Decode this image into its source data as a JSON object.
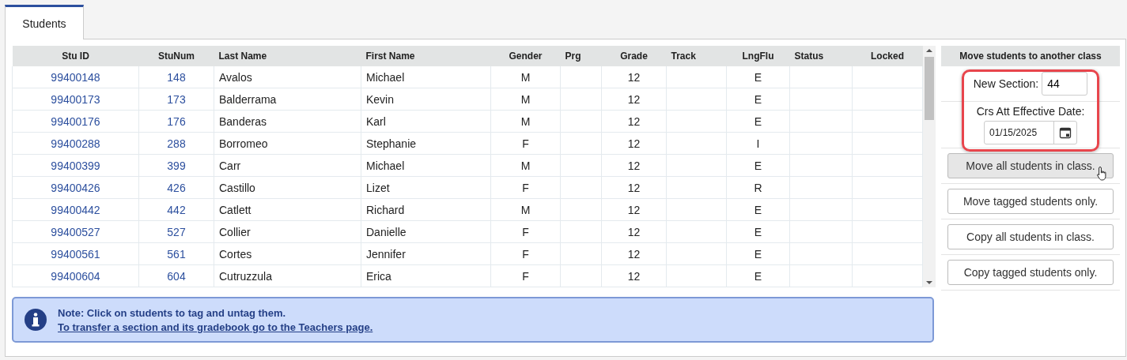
{
  "tabs": [
    {
      "label": "Students",
      "selected": true
    }
  ],
  "table": {
    "columns": [
      "Stu ID",
      "StuNum",
      "Last Name",
      "First Name",
      "Gender",
      "Prg",
      "Grade",
      "Track",
      "LngFlu",
      "Status",
      "Locked"
    ],
    "rows": [
      [
        "99400148",
        "148",
        "Avalos",
        "Michael",
        "M",
        "",
        "12",
        "",
        "E",
        "",
        ""
      ],
      [
        "99400173",
        "173",
        "Balderrama",
        "Kevin",
        "M",
        "",
        "12",
        "",
        "E",
        "",
        ""
      ],
      [
        "99400176",
        "176",
        "Banderas",
        "Karl",
        "M",
        "",
        "12",
        "",
        "E",
        "",
        ""
      ],
      [
        "99400288",
        "288",
        "Borromeo",
        "Stephanie",
        "F",
        "",
        "12",
        "",
        "I",
        "",
        ""
      ],
      [
        "99400399",
        "399",
        "Carr",
        "Michael",
        "M",
        "",
        "12",
        "",
        "E",
        "",
        ""
      ],
      [
        "99400426",
        "426",
        "Castillo",
        "Lizet",
        "F",
        "",
        "12",
        "",
        "R",
        "",
        ""
      ],
      [
        "99400442",
        "442",
        "Catlett",
        "Richard",
        "M",
        "",
        "12",
        "",
        "E",
        "",
        ""
      ],
      [
        "99400527",
        "527",
        "Collier",
        "Danielle",
        "F",
        "",
        "12",
        "",
        "E",
        "",
        ""
      ],
      [
        "99400561",
        "561",
        "Cortes",
        "Jennifer",
        "F",
        "",
        "12",
        "",
        "E",
        "",
        ""
      ],
      [
        "99400604",
        "604",
        "Cutruzzula",
        "Erica",
        "F",
        "",
        "12",
        "",
        "E",
        "",
        ""
      ]
    ]
  },
  "note": {
    "text": "Note: Click on students to tag and untag them.",
    "link": "To transfer a section and its gradebook go to the Teachers page."
  },
  "move_panel": {
    "title": "Move students to another class",
    "new_section_label": "New Section:",
    "new_section_value": "44",
    "date_label": "Crs Att Effective Date:",
    "date_value": "01/15/2025",
    "buttons": [
      {
        "label": "Move all students in class.",
        "hovered": true
      },
      {
        "label": "Move tagged students only.",
        "hovered": false
      },
      {
        "label": "Copy all students in class.",
        "hovered": false
      },
      {
        "label": "Copy tagged students only.",
        "hovered": false
      }
    ]
  }
}
